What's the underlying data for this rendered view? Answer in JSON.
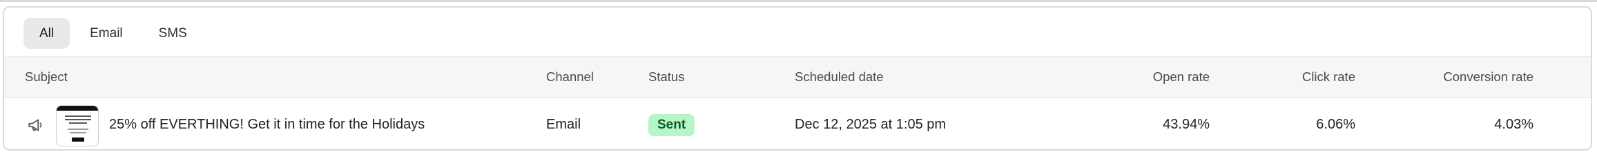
{
  "tabs": [
    {
      "label": "All",
      "active": true
    },
    {
      "label": "Email",
      "active": false
    },
    {
      "label": "SMS",
      "active": false
    }
  ],
  "table": {
    "columns": {
      "subject": "Subject",
      "channel": "Channel",
      "status": "Status",
      "scheduled_date": "Scheduled date",
      "open_rate": "Open rate",
      "click_rate": "Click rate",
      "conversion_rate": "Conversion rate"
    },
    "rows": [
      {
        "icon": "megaphone-icon",
        "subject": "25% off EVERTHING! Get it in time for the Holidays",
        "channel": "Email",
        "status": "Sent",
        "scheduled_date": "Dec 12, 2025 at 1:05 pm",
        "open_rate": "43.94%",
        "click_rate": "6.06%",
        "conversion_rate": "4.03%"
      }
    ]
  },
  "colors": {
    "status_sent_bg": "#b5f5c7",
    "status_sent_text": "#0b5a2a",
    "header_bg": "#f6f6f6",
    "active_tab_bg": "#e9e9e9"
  }
}
